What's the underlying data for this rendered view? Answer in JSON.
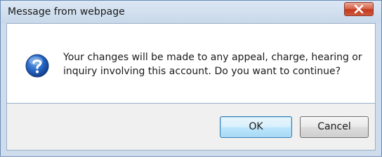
{
  "dialog": {
    "title": "Message from webpage",
    "message": "Your changes will be made to any appeal, charge, hearing or inquiry involving this account. Do you want to continue?",
    "icon": "question-icon",
    "buttons": {
      "ok_label": "OK",
      "cancel_label": "Cancel"
    },
    "colors": {
      "close_button": "#c8462c",
      "default_button_border": "#3c7fb1"
    }
  }
}
